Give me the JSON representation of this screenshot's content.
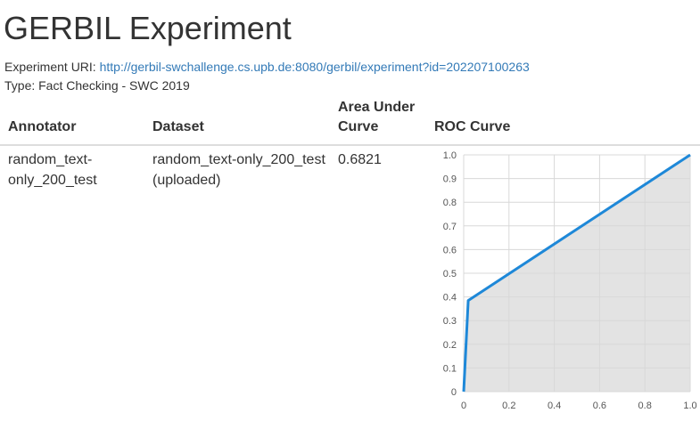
{
  "page": {
    "title": "GERBIL Experiment",
    "uri_label": "Experiment URI: ",
    "uri": "http://gerbil-swchallenge.cs.upb.de:8080/gerbil/experiment?id=202207100263",
    "type_text": "Type: Fact Checking - SWC 2019"
  },
  "table": {
    "headers": {
      "annotator": "Annotator",
      "dataset": "Dataset",
      "auc_line1": "Area Under",
      "auc_line2": "Curve",
      "roc": "ROC Curve"
    },
    "row": {
      "annotator_line1": "random_text-",
      "annotator_line2": "only_200_test",
      "dataset_line1": "random_text-only_200_test",
      "dataset_line2": "(uploaded)",
      "auc": "0.6821"
    }
  },
  "colors": {
    "link": "#337ab7",
    "roc_line": "#1e88d8",
    "roc_fill": "#e3e3e3",
    "grid": "#d8d8d8"
  },
  "chart_data": {
    "type": "area",
    "x": [
      0,
      0.02,
      1.0
    ],
    "y": [
      0,
      0.385,
      1.0
    ],
    "xlim": [
      0,
      1
    ],
    "ylim": [
      0,
      1
    ],
    "x_ticks": [
      "0",
      "0.2",
      "0.4",
      "0.6",
      "0.8",
      "1.0"
    ],
    "y_ticks": [
      "0",
      "0.1",
      "0.2",
      "0.3",
      "0.4",
      "0.5",
      "0.6",
      "0.7",
      "0.8",
      "0.9",
      "1.0"
    ],
    "grid": true,
    "title": "",
    "xlabel": "",
    "ylabel": ""
  }
}
